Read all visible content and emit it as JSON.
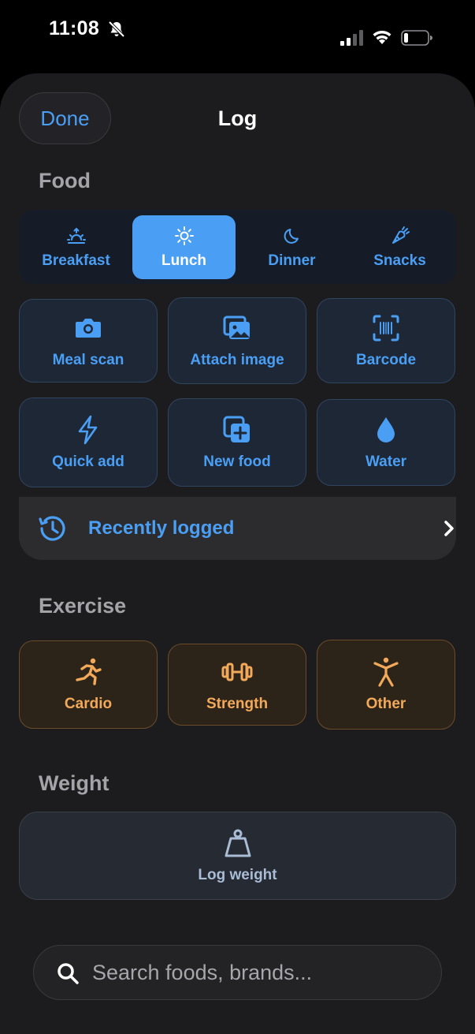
{
  "status_bar": {
    "time": "11:08"
  },
  "header": {
    "done_label": "Done",
    "title": "Log"
  },
  "food": {
    "title": "Food",
    "meals": [
      {
        "label": "Breakfast",
        "icon": "sunrise-icon",
        "active": false
      },
      {
        "label": "Lunch",
        "icon": "sun-icon",
        "active": true
      },
      {
        "label": "Dinner",
        "icon": "moon-icon",
        "active": false
      },
      {
        "label": "Snacks",
        "icon": "carrot-icon",
        "active": false
      }
    ],
    "actions": [
      {
        "label": "Meal scan",
        "icon": "camera-icon"
      },
      {
        "label": "Attach image",
        "icon": "images-icon"
      },
      {
        "label": "Barcode",
        "icon": "barcode-scan-icon"
      },
      {
        "label": "Quick add",
        "icon": "bolt-icon"
      },
      {
        "label": "New food",
        "icon": "plus-square-icon"
      },
      {
        "label": "Water",
        "icon": "water-drop-icon"
      }
    ],
    "recently_logged": "Recently logged"
  },
  "exercise": {
    "title": "Exercise",
    "items": [
      {
        "label": "Cardio",
        "icon": "running-icon"
      },
      {
        "label": "Strength",
        "icon": "dumbbell-icon"
      },
      {
        "label": "Other",
        "icon": "figure-icon"
      }
    ]
  },
  "weight": {
    "title": "Weight",
    "log_label": "Log weight",
    "icon": "scale-weight-icon"
  },
  "search": {
    "placeholder": "Search foods, brands..."
  },
  "colors": {
    "accent_blue": "#4a9ff5",
    "accent_orange": "#f3a95a",
    "sheet_bg": "#1c1c1e"
  }
}
